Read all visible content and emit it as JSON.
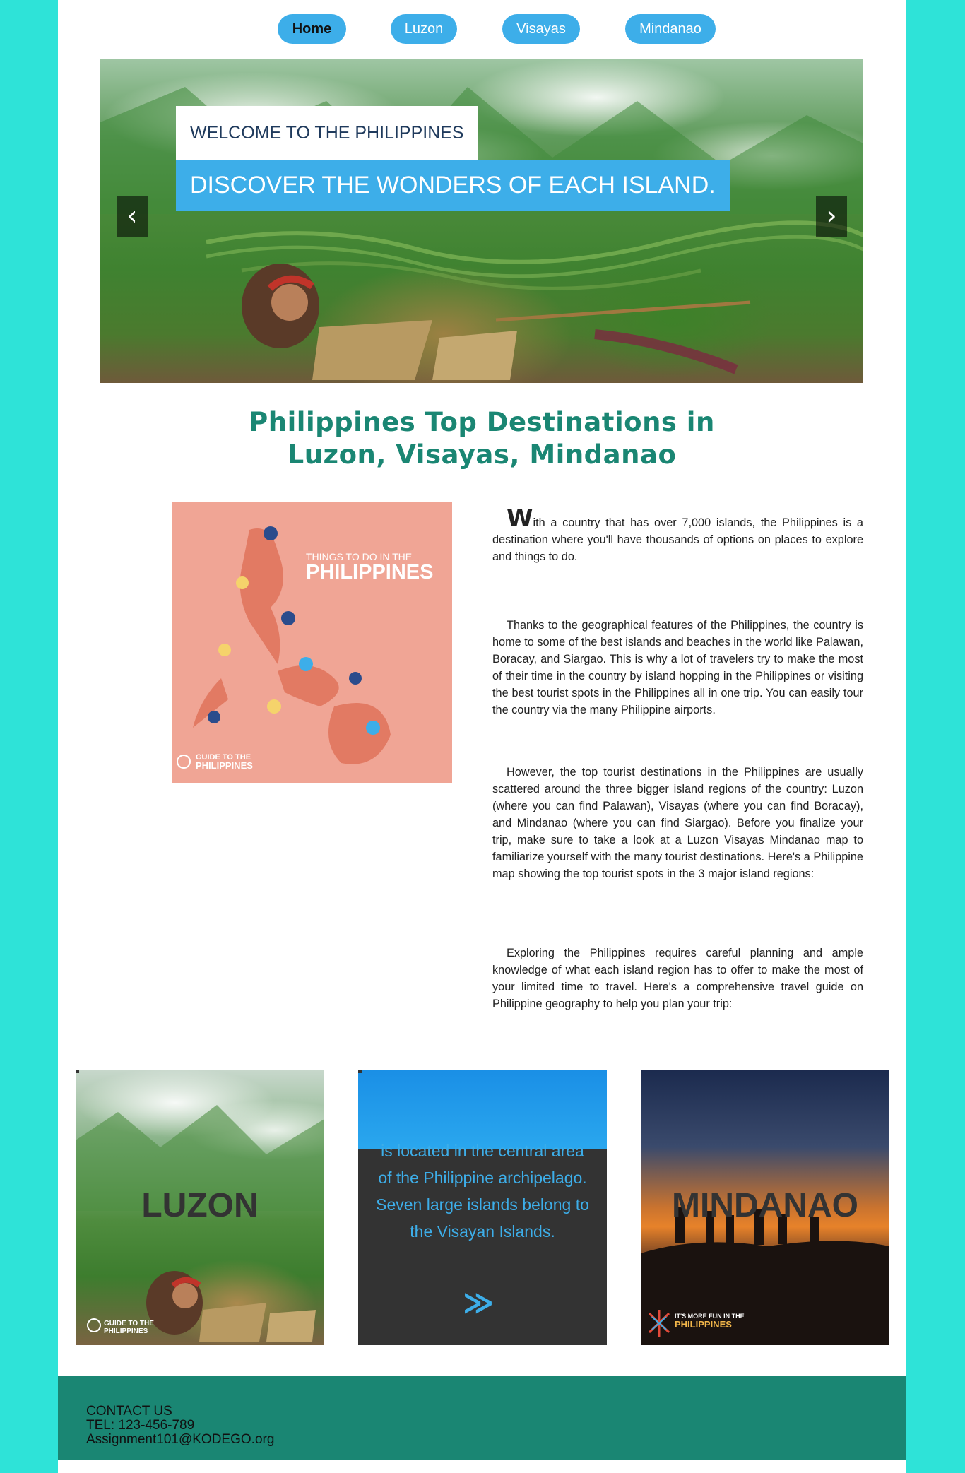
{
  "nav": {
    "items": [
      {
        "label": "Home"
      },
      {
        "label": "Luzon"
      },
      {
        "label": "Visayas"
      },
      {
        "label": "Mindanao"
      }
    ]
  },
  "hero": {
    "title_small": "WELCOME TO THE PHILIPPINES",
    "title_big": "DISCOVER THE WONDERS OF EACH ISLAND.",
    "prev_glyph": "‹",
    "next_glyph": "›"
  },
  "main": {
    "heading_line1": "Philippines Top Destinations in",
    "heading_line2": "Luzon, Visayas, Mindanao",
    "map": {
      "title_small": "THINGS TO DO IN THE",
      "title_big": "PHILIPPINES",
      "logo_line1": "GUIDE TO THE",
      "logo_line2": "PHILIPPINES"
    },
    "paragraphs": [
      {
        "dropcap": "W",
        "text": "ith a country that has over 7,000 islands, the Philippines is a destination where you'll have thousands of options on places to explore and things to do."
      },
      {
        "text": "Thanks to the geographical features of the Philippines, the country is home to some of the best islands and beaches in the world like Palawan, Boracay, and Siargao. This is why a lot of travelers try to make the most of their time in the country by island hopping in the Philippines or visiting the best tourist spots in the Philippines all in one trip. You can easily tour the country via the many Philippine airports."
      },
      {
        "text": "However, the top tourist destinations in the Philippines are usually scattered around the three bigger island regions of the country: Luzon (where you can find Palawan), Visayas (where you can find Boracay), and Mindanao (where you can find Siargao). Before you finalize your trip, make sure to take a look at a Luzon Visayas Mindanao map to familiarize yourself with the many tourist destinations. Here's a Philippine map showing the top tourist spots in the 3 major island regions:"
      },
      {
        "text": "Exploring the Philippines requires careful planning and ample knowledge of what each island region has to offer to make the most of your limited time to travel. Here's a comprehensive travel guide on Philippine geography to help you plan your trip:"
      }
    ]
  },
  "cards": {
    "luzon": {
      "label": "LUZON",
      "logo_line1": "GUIDE TO THE",
      "logo_line2": "PHILIPPINES"
    },
    "visayas": {
      "text": "is located in the central area of the Philippine archipelago. Seven large islands belong to the Visayan Islands.",
      "arrow": "≫"
    },
    "mindanao": {
      "label": "MINDANAO",
      "logo_line1": "IT'S MORE FUN IN THE",
      "logo_line2": "PHILIPPINES"
    }
  },
  "footer": {
    "contact": "CONTACT US",
    "tel": "TEL: 123-456-789",
    "email": "Assignment101@KODEGO.org"
  },
  "colors": {
    "background": "#2ee3d8",
    "accent_blue": "#3daee9",
    "heading_teal": "#1a8673",
    "footer": "#1a8673"
  }
}
